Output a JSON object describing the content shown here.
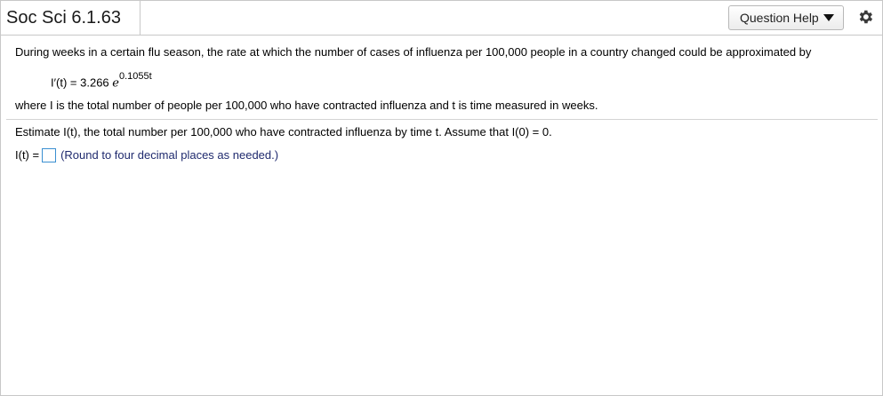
{
  "header": {
    "title": "Soc Sci 6.1.63",
    "help_label": "Question Help"
  },
  "question": {
    "intro": "During  weeks in a certain flu season, the rate at which the number of cases of influenza per 100,000 people in a country changed could be approximated by",
    "formula_lhs": "I′(t) = 3.266 ",
    "formula_base": "e",
    "formula_exponent": "0.1055t",
    "definition": "where I is the total number of people per 100,000 who have contracted influenza and t is time measured in weeks.",
    "prompt": "Estimate I(t), the total number per 100,000 who have contracted influenza by time t. Assume that I(0) = 0.",
    "answer_label": "I(t) =",
    "answer_value": "",
    "hint": "(Round to four decimal places as needed.)"
  },
  "icons": {
    "help_caret": "caret-down-icon",
    "settings": "gear-icon"
  }
}
